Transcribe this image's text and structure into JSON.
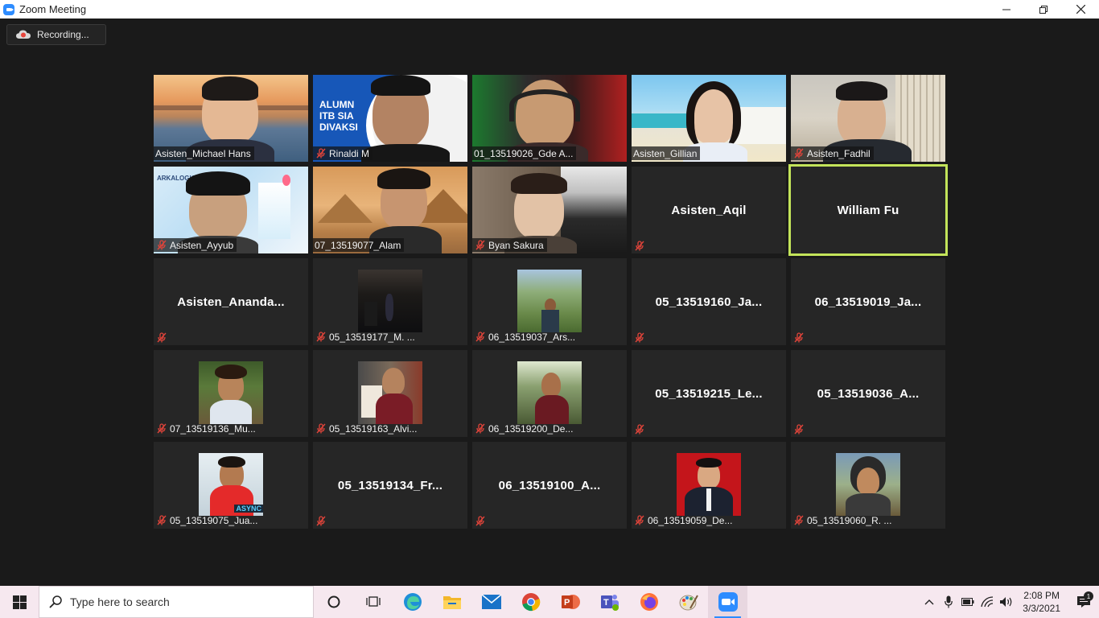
{
  "window": {
    "title": "Zoom Meeting"
  },
  "recording": {
    "label": "Recording..."
  },
  "participants": [
    {
      "name": "Asisten_Michael Hans",
      "muted": false
    },
    {
      "name": "Rinaldi M",
      "muted": true
    },
    {
      "name": "01_13519026_Gde A...",
      "muted": false
    },
    {
      "name": "Asisten_Gillian",
      "muted": false
    },
    {
      "name": "Asisten_Fadhil",
      "muted": true
    },
    {
      "name": "Asisten_Ayyub",
      "muted": true
    },
    {
      "name": "07_13519077_Alam",
      "muted": false
    },
    {
      "name": "Byan Sakura",
      "muted": true
    },
    {
      "name": "Asisten_Aqil",
      "muted": true
    },
    {
      "name": "William Fu",
      "muted": false
    },
    {
      "name": "Asisten_Ananda...",
      "muted": true
    },
    {
      "name": "05_13519177_M. ...",
      "muted": true
    },
    {
      "name": "06_13519037_Ars...",
      "muted": true
    },
    {
      "name": "05_13519160_Ja...",
      "muted": true
    },
    {
      "name": "06_13519019_Ja...",
      "muted": true
    },
    {
      "name": "07_13519136_Mu...",
      "muted": true
    },
    {
      "name": "05_13519163_Alvi...",
      "muted": true
    },
    {
      "name": "06_13519200_De...",
      "muted": true
    },
    {
      "name": "05_13519215_Le...",
      "muted": true
    },
    {
      "name": "05_13519036_A...",
      "muted": true
    },
    {
      "name": "05_13519075_Jua...",
      "muted": true
    },
    {
      "name": "05_13519134_Fr...",
      "muted": true
    },
    {
      "name": "06_13519100_A...",
      "muted": true
    },
    {
      "name": "06_13519059_De...",
      "muted": true
    },
    {
      "name": "05_13519060_R. ...",
      "muted": true
    }
  ],
  "taskbar": {
    "search_placeholder": "Type here to search",
    "time": "2:08 PM",
    "date": "3/3/2021",
    "notification_count": "1"
  }
}
